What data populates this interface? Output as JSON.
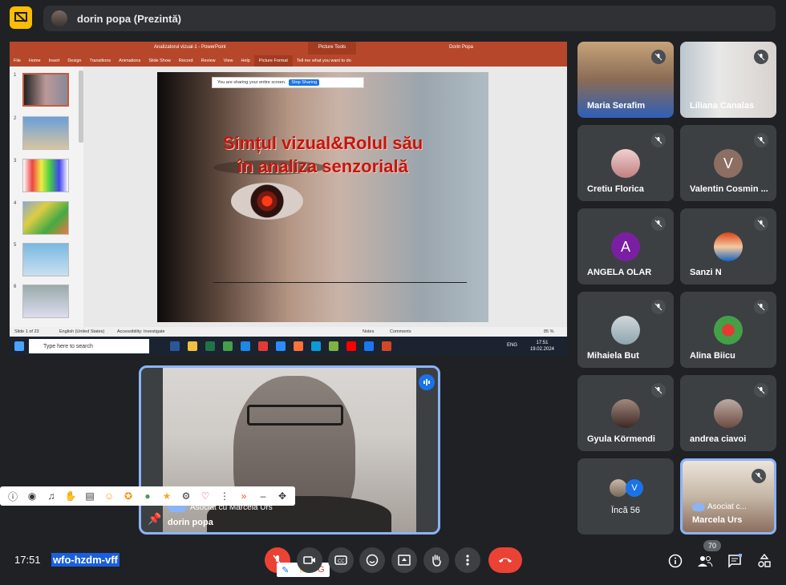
{
  "meeting": {
    "presenter_label": "dorin popa (Prezintă)",
    "time": "17:51",
    "code": "wfo-hzdm-vff",
    "participant_count": "70"
  },
  "powerpoint": {
    "window_title": "Analizatorul vizual-1 - PowerPoint",
    "picture_tools": "Picture Tools",
    "user": "Dorin Popa",
    "tabs": [
      "File",
      "Home",
      "Insert",
      "Design",
      "Transitions",
      "Animations",
      "Slide Show",
      "Record",
      "Review",
      "View",
      "Help",
      "Picture Format",
      "Tell me what you want to do"
    ],
    "slide_numbers": [
      "1",
      "2",
      "3",
      "4",
      "5",
      "6"
    ],
    "slide_title_line1": "Simțul vizual&Rolul său",
    "slide_title_line2": "în analiza senzorială",
    "share_message": "You are sharing your entire screen.",
    "stop_sharing": "Stop Sharing",
    "status_slide": "Slide 1 of 23",
    "status_lang": "English (United States)",
    "status_access": "Accessibility: Investigate",
    "status_notes": "Notes",
    "status_comments": "Comments",
    "zoom": "85 %",
    "taskbar_search": "Type here to search",
    "taskbar_lang": "ENG",
    "taskbar_time": "17:51",
    "taskbar_date": "19.02.2024"
  },
  "presenter_tile": {
    "assoc_label": "Asociat cu Marcela Urs",
    "name": "dorin popa"
  },
  "participants": [
    {
      "name": "Maria Serafim"
    },
    {
      "name": "Liliana Canalas"
    },
    {
      "name": "Cretiu Florica"
    },
    {
      "name": "Valentin Cosmin ...",
      "initial": "V"
    },
    {
      "name": "ANGELA OLAR",
      "initial": "A"
    },
    {
      "name": "Sanzi N"
    },
    {
      "name": "Mihaiela But"
    },
    {
      "name": "Alina Biicu"
    },
    {
      "name": "Gyula Körmendi"
    },
    {
      "name": "andrea ciavoi"
    },
    {
      "name": "Încă 56",
      "initial": "V"
    },
    {
      "name": "Marcela Urs",
      "assoc": "Asociat c..."
    }
  ],
  "colors": {
    "accent": "#8ab4f8",
    "danger": "#ea4335",
    "ppt": "#b7472a",
    "background": "#202124"
  }
}
